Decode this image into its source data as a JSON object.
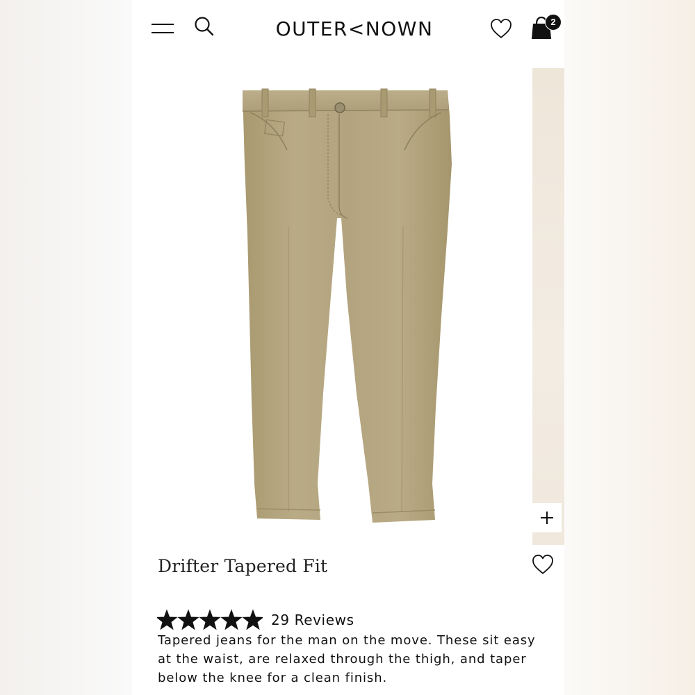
{
  "header": {
    "logo": "OUTER<NOWN",
    "cart_count": "2",
    "menu_icon": "hamburger-menu-icon",
    "search_icon": "search-icon",
    "wishlist_icon": "heart-icon",
    "cart_icon": "shopping-bag-icon"
  },
  "gallery": {
    "zoom_label": "+",
    "product_color": "#b3a584"
  },
  "product": {
    "title": "Drifter Tapered Fit",
    "rating": 5,
    "rating_max": 5,
    "reviews_label": "29 Reviews",
    "description": "Tapered jeans for the man on the move. These sit easy at the waist, are relaxed through the thigh, and taper below the knee for a clean finish."
  }
}
